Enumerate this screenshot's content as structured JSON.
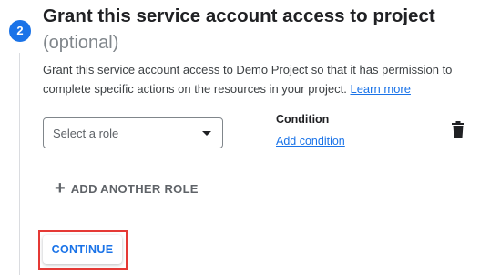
{
  "step": {
    "number": "2",
    "title": "Grant this service account access to project",
    "subtitle": "(optional)",
    "description": "Grant this service account access to Demo Project so that it has permission to complete specific actions on the resources in your project.",
    "learn_more": "Learn more"
  },
  "role": {
    "placeholder": "Select a role"
  },
  "condition": {
    "label": "Condition",
    "add_link": "Add condition"
  },
  "add_role_label": "ADD ANOTHER ROLE",
  "continue_label": "CONTINUE",
  "colors": {
    "accent": "#1a73e8",
    "highlight": "#e53935"
  },
  "icons": [
    "trash-icon",
    "plus-icon",
    "dropdown-caret-icon"
  ]
}
